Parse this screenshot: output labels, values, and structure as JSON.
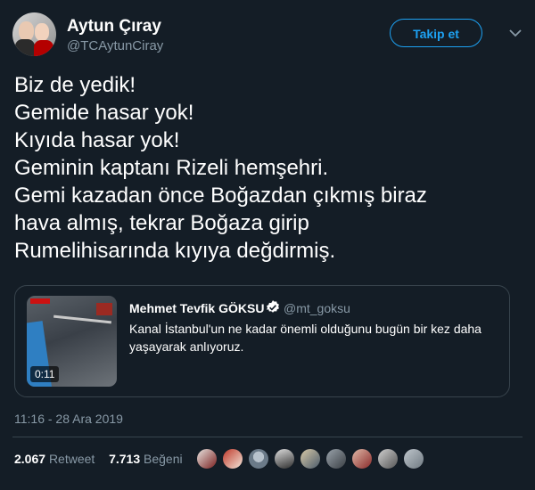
{
  "author": {
    "name": "Aytun Çıray",
    "handle": "@TCAytunCiray"
  },
  "follow_button_label": "Takip et",
  "tweet_lines": [
    "Biz de yedik!",
    "Gemide hasar yok!",
    "Kıyıda hasar yok!",
    "Geminin kaptanı Rizeli hemşehri.",
    "Gemi kazadan önce Boğazdan çıkmış biraz",
    "hava almış, tekrar Boğaza girip",
    "Rumelihisarında kıyıya değdirmiş."
  ],
  "quoted": {
    "name": "Mehmet Tevfik GÖKSU",
    "handle": "@mt_goksu",
    "text": "Kanal İstanbul'un ne kadar önemli olduğunu bugün bir kez daha yaşayarak anlıyoruz.",
    "video_duration": "0:11"
  },
  "timestamp": "11:16 - 28 Ara 2019",
  "stats": {
    "retweets_count": "2.067",
    "retweets_label": "Retweet",
    "likes_count": "7.713",
    "likes_label": "Beğeni"
  },
  "colors": {
    "background": "#141d26",
    "accent": "#1da1f2",
    "secondary_text": "#8899a6",
    "border": "#38444d"
  },
  "icons": [
    "chevron-down-icon",
    "verified-badge-icon"
  ]
}
